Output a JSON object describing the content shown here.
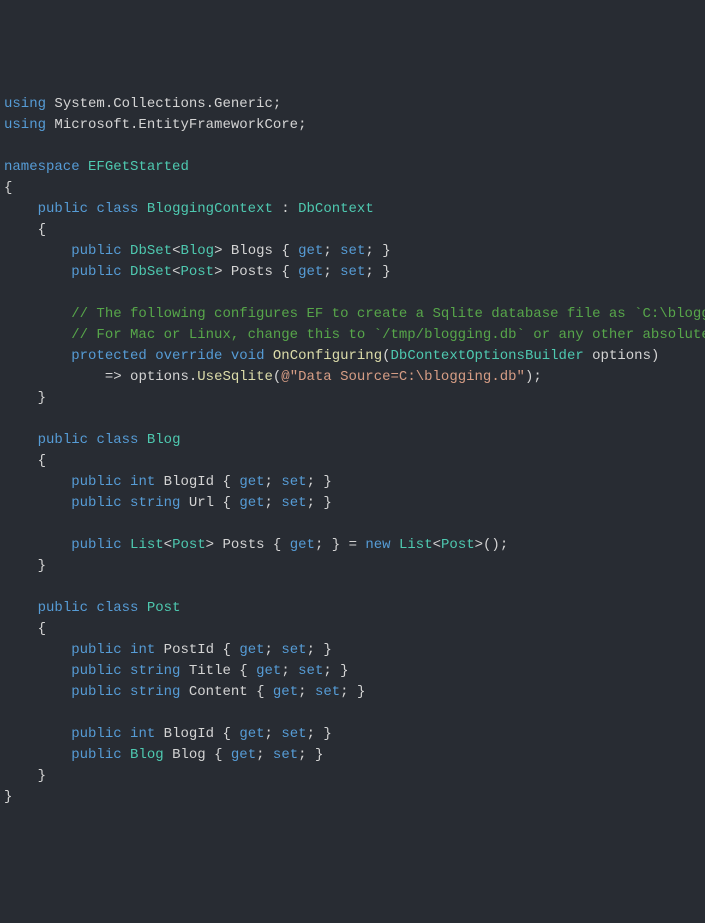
{
  "code": {
    "using1": "using",
    "using1_ns": "System.Collections.Generic",
    "using2": "using",
    "using2_ns": "Microsoft.EntityFrameworkCore",
    "namespace_kw": "namespace",
    "namespace_name": "EFGetStarted",
    "public_kw": "public",
    "class_kw": "class",
    "class1_name": "BloggingContext",
    "inherits": "DbContext",
    "dbset_type": "DbSet",
    "blog_type": "Blog",
    "post_type": "Post",
    "blogs_prop": "Blogs",
    "posts_prop": "Posts",
    "get_kw": "get",
    "set_kw": "set",
    "comment1": "// The following configures EF to create a Sqlite database file as `C:\\blogging.db",
    "comment2": "// For Mac or Linux, change this to `/tmp/blogging.db` or any other absolute path.",
    "protected_kw": "protected",
    "override_kw": "override",
    "void_kw": "void",
    "onconfiguring": "OnConfiguring",
    "optionsbuilder_type": "DbContextOptionsBuilder",
    "options_param": "options",
    "usesqlite": "UseSqlite",
    "conn_string": "@\"Data Source=C:\\blogging.db\"",
    "class2_name": "Blog",
    "blogid_prop": "BlogId",
    "url_prop": "Url",
    "list_type": "List",
    "posts_list_prop": "Posts",
    "new_kw": "new",
    "class3_name": "Post",
    "postid_prop": "PostId",
    "title_prop": "Title",
    "content_prop": "Content",
    "blogid_fk": "BlogId",
    "blog_nav": "Blog",
    "int_kw": "int",
    "string_kw": "string"
  }
}
